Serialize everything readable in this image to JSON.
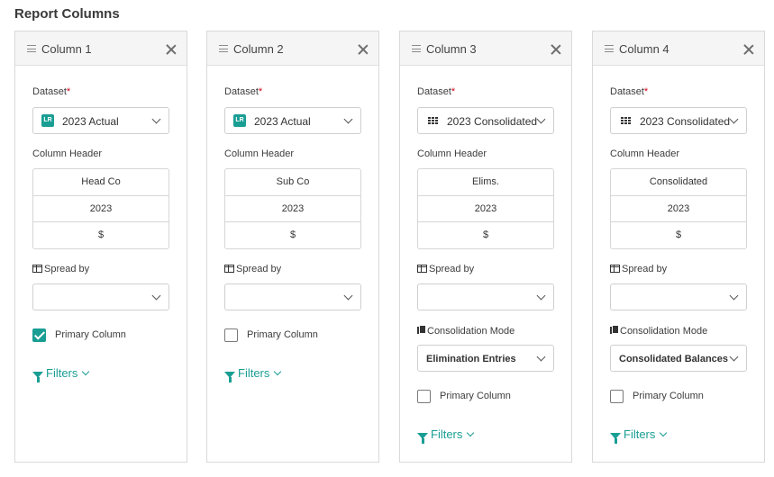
{
  "page_title": "Report Columns",
  "dataset_label": "Dataset",
  "required_marker": "*",
  "column_header_label": "Column Header",
  "spread_by_label": "Spread by",
  "consolidation_mode_label": "Consolidation Mode",
  "primary_column_label": "Primary Column",
  "filters_label": "Filters",
  "accent_color": "#1a9e94",
  "columns": [
    {
      "title": "Column 1",
      "dataset": {
        "badge": "LR",
        "icon": "lr-badge-icon",
        "value": "2023 Actual"
      },
      "header_rows": [
        "Head Co",
        "2023",
        "$"
      ],
      "spread_by_value": "",
      "primary": true
    },
    {
      "title": "Column 2",
      "dataset": {
        "badge": "LR",
        "icon": "lr-badge-icon",
        "value": "2023 Actual"
      },
      "header_rows": [
        "Sub Co",
        "2023",
        "$"
      ],
      "spread_by_value": "",
      "primary": false
    },
    {
      "title": "Column 3",
      "dataset": {
        "icon": "grid-icon",
        "value": "2023 Consolidated"
      },
      "header_rows": [
        "Elims.",
        "2023",
        "$"
      ],
      "spread_by_value": "",
      "consolidation_mode": "Elimination Entries",
      "primary": false
    },
    {
      "title": "Column 4",
      "dataset": {
        "icon": "grid-icon",
        "value": "2023 Consolidated"
      },
      "header_rows": [
        "Consolidated",
        "2023",
        "$"
      ],
      "spread_by_value": "",
      "consolidation_mode": "Consolidated Balances",
      "primary": false
    }
  ]
}
